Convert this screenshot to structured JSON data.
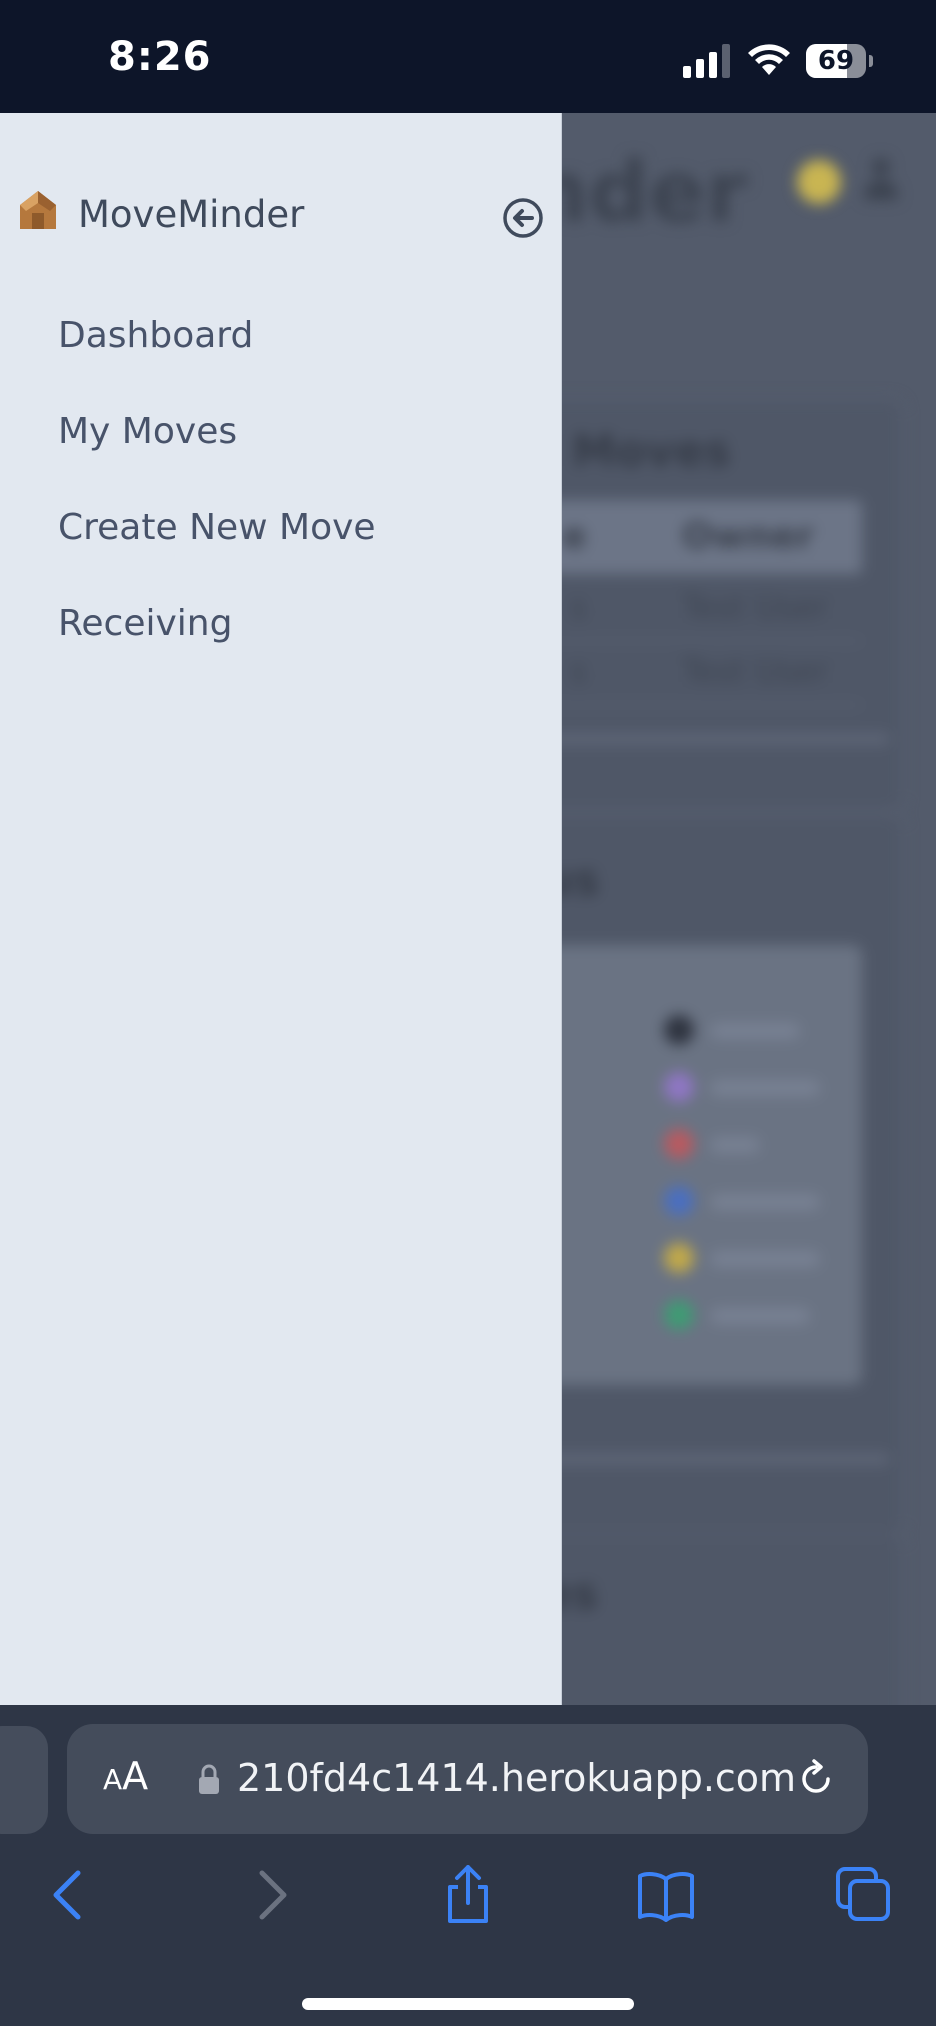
{
  "status_bar": {
    "time": "8:26",
    "battery_level": "69",
    "battery_fraction": 0.69,
    "signal_bars": 3,
    "signal_bars_total": 4
  },
  "drawer": {
    "brand_name": "MoveMinder",
    "brand_logo_icon": "cardboard-box-house-icon",
    "collapse_icon": "circle-arrow-left-icon",
    "nav_items": [
      {
        "label": "Dashboard"
      },
      {
        "label": "My Moves"
      },
      {
        "label": "Create New Move"
      },
      {
        "label": "Receiving"
      }
    ]
  },
  "background_page": {
    "heading_fragment": "inder",
    "card1_title_fragment": "Moves",
    "table_header_fragments": [
      "e",
      "Owner"
    ],
    "table_rows": [
      [
        "s",
        "Test User"
      ],
      [
        "s",
        "Test User"
      ]
    ],
    "card2_title_fragment": "us",
    "card3_title_fragment": "es",
    "legend_colors": [
      "#2f3440",
      "#8f76c4",
      "#b85a60",
      "#4a6fc0",
      "#c1a94a",
      "#3f9b74"
    ]
  },
  "safari": {
    "text_size_small": "A",
    "text_size_big": "A",
    "url": "210fd4c1414.herokuapp.com",
    "icons": {
      "back": "chevron-left-icon",
      "forward": "chevron-right-icon",
      "share": "share-icon",
      "bookmarks": "book-icon",
      "tabs": "tabs-icon",
      "reload": "reload-icon",
      "lock": "lock-icon"
    },
    "accent_color": "#3b82f6"
  }
}
